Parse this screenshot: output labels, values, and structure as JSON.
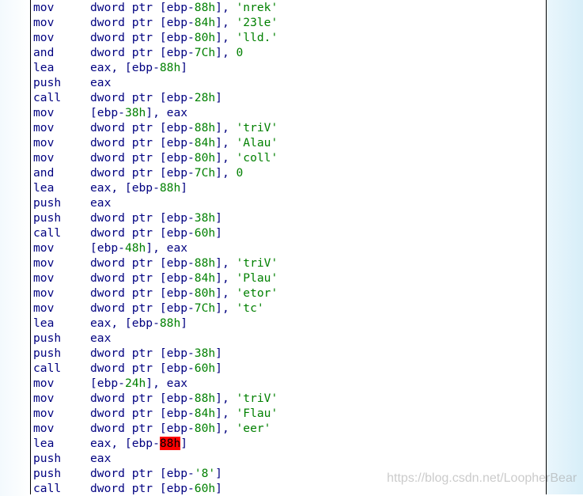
{
  "colors": {
    "mnemonic": "#000080",
    "number": "#008000",
    "highlight": "#ff0000"
  },
  "watermark": "https://blog.csdn.net/LoopherBear",
  "lines": [
    {
      "op": "mov",
      "a": [
        [
          "dword ptr [ebp-",
          ""
        ],
        [
          "88h",
          "g"
        ],
        [
          "], ",
          ""
        ],
        [
          "'nrek'",
          "g"
        ]
      ]
    },
    {
      "op": "mov",
      "a": [
        [
          "dword ptr [ebp-",
          ""
        ],
        [
          "84h",
          "g"
        ],
        [
          "], ",
          ""
        ],
        [
          "'23le'",
          "g"
        ]
      ]
    },
    {
      "op": "mov",
      "a": [
        [
          "dword ptr [ebp-",
          ""
        ],
        [
          "80h",
          "g"
        ],
        [
          "], ",
          ""
        ],
        [
          "'lld.'",
          "g"
        ]
      ]
    },
    {
      "op": "and",
      "a": [
        [
          "dword ptr [ebp-",
          ""
        ],
        [
          "7Ch",
          "g"
        ],
        [
          "], ",
          ""
        ],
        [
          "0",
          "g"
        ]
      ]
    },
    {
      "op": "lea",
      "a": [
        [
          "eax, [ebp-",
          ""
        ],
        [
          "88h",
          "g"
        ],
        [
          "]",
          ""
        ]
      ]
    },
    {
      "op": "push",
      "a": [
        [
          "eax",
          ""
        ]
      ]
    },
    {
      "op": "call",
      "a": [
        [
          "dword ptr [ebp-",
          ""
        ],
        [
          "28h",
          "g"
        ],
        [
          "]",
          ""
        ]
      ]
    },
    {
      "op": "mov",
      "a": [
        [
          "[ebp-",
          ""
        ],
        [
          "38h",
          "g"
        ],
        [
          "], eax",
          ""
        ]
      ]
    },
    {
      "op": "mov",
      "a": [
        [
          "dword ptr [ebp-",
          ""
        ],
        [
          "88h",
          "g"
        ],
        [
          "], ",
          ""
        ],
        [
          "'triV'",
          "g"
        ]
      ]
    },
    {
      "op": "mov",
      "a": [
        [
          "dword ptr [ebp-",
          ""
        ],
        [
          "84h",
          "g"
        ],
        [
          "], ",
          ""
        ],
        [
          "'Alau'",
          "g"
        ]
      ]
    },
    {
      "op": "mov",
      "a": [
        [
          "dword ptr [ebp-",
          ""
        ],
        [
          "80h",
          "g"
        ],
        [
          "], ",
          ""
        ],
        [
          "'coll'",
          "g"
        ]
      ]
    },
    {
      "op": "and",
      "a": [
        [
          "dword ptr [ebp-",
          ""
        ],
        [
          "7Ch",
          "g"
        ],
        [
          "], ",
          ""
        ],
        [
          "0",
          "g"
        ]
      ]
    },
    {
      "op": "lea",
      "a": [
        [
          "eax, [ebp-",
          ""
        ],
        [
          "88h",
          "g"
        ],
        [
          "]",
          ""
        ]
      ]
    },
    {
      "op": "push",
      "a": [
        [
          "eax",
          ""
        ]
      ]
    },
    {
      "op": "push",
      "a": [
        [
          "dword ptr [ebp-",
          ""
        ],
        [
          "38h",
          "g"
        ],
        [
          "]",
          ""
        ]
      ]
    },
    {
      "op": "call",
      "a": [
        [
          "dword ptr [ebp-",
          ""
        ],
        [
          "60h",
          "g"
        ],
        [
          "]",
          ""
        ]
      ]
    },
    {
      "op": "mov",
      "a": [
        [
          "[ebp-",
          ""
        ],
        [
          "48h",
          "g"
        ],
        [
          "], eax",
          ""
        ]
      ]
    },
    {
      "op": "mov",
      "a": [
        [
          "dword ptr [ebp-",
          ""
        ],
        [
          "88h",
          "g"
        ],
        [
          "], ",
          ""
        ],
        [
          "'triV'",
          "g"
        ]
      ]
    },
    {
      "op": "mov",
      "a": [
        [
          "dword ptr [ebp-",
          ""
        ],
        [
          "84h",
          "g"
        ],
        [
          "], ",
          ""
        ],
        [
          "'Plau'",
          "g"
        ]
      ]
    },
    {
      "op": "mov",
      "a": [
        [
          "dword ptr [ebp-",
          ""
        ],
        [
          "80h",
          "g"
        ],
        [
          "], ",
          ""
        ],
        [
          "'etor'",
          "g"
        ]
      ]
    },
    {
      "op": "mov",
      "a": [
        [
          "dword ptr [ebp-",
          ""
        ],
        [
          "7Ch",
          "g"
        ],
        [
          "], ",
          ""
        ],
        [
          "'tc'",
          "g"
        ]
      ]
    },
    {
      "op": "lea",
      "a": [
        [
          "eax, [ebp-",
          ""
        ],
        [
          "88h",
          "g"
        ],
        [
          "]",
          ""
        ]
      ]
    },
    {
      "op": "push",
      "a": [
        [
          "eax",
          ""
        ]
      ]
    },
    {
      "op": "push",
      "a": [
        [
          "dword ptr [ebp-",
          ""
        ],
        [
          "38h",
          "g"
        ],
        [
          "]",
          ""
        ]
      ]
    },
    {
      "op": "call",
      "a": [
        [
          "dword ptr [ebp-",
          ""
        ],
        [
          "60h",
          "g"
        ],
        [
          "]",
          ""
        ]
      ]
    },
    {
      "op": "mov",
      "a": [
        [
          "[ebp-",
          ""
        ],
        [
          "24h",
          "g"
        ],
        [
          "], eax",
          ""
        ]
      ]
    },
    {
      "op": "mov",
      "a": [
        [
          "dword ptr [ebp-",
          ""
        ],
        [
          "88h",
          "g"
        ],
        [
          "], ",
          ""
        ],
        [
          "'triV'",
          "g"
        ]
      ]
    },
    {
      "op": "mov",
      "a": [
        [
          "dword ptr [ebp-",
          ""
        ],
        [
          "84h",
          "g"
        ],
        [
          "], ",
          ""
        ],
        [
          "'Flau'",
          "g"
        ]
      ]
    },
    {
      "op": "mov",
      "a": [
        [
          "dword ptr [ebp-",
          ""
        ],
        [
          "80h",
          "g"
        ],
        [
          "], ",
          ""
        ],
        [
          "'eer'",
          "g"
        ]
      ]
    },
    {
      "op": "lea",
      "a": [
        [
          "eax, [ebp-",
          ""
        ],
        [
          "88h",
          "h"
        ],
        [
          "]",
          ""
        ]
      ]
    },
    {
      "op": "push",
      "a": [
        [
          "eax",
          ""
        ]
      ]
    },
    {
      "op": "push",
      "a": [
        [
          "dword ptr [ebp-",
          ""
        ],
        [
          "'8'",
          "g"
        ],
        [
          "]",
          ""
        ]
      ]
    },
    {
      "op": "call",
      "a": [
        [
          "dword ptr [ebp-",
          ""
        ],
        [
          "60h",
          "g"
        ],
        [
          "]",
          ""
        ]
      ]
    }
  ]
}
